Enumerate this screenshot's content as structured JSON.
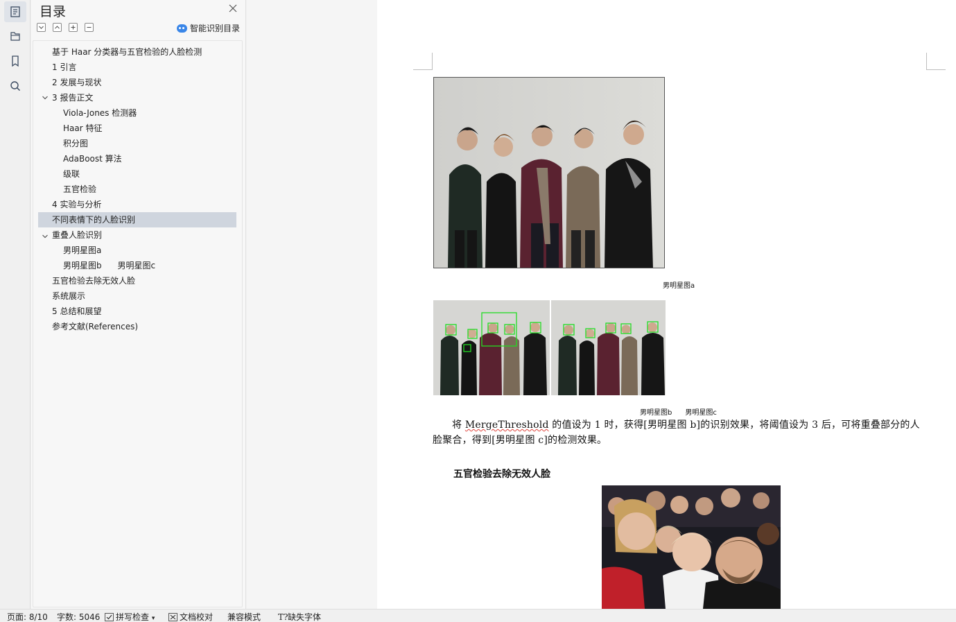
{
  "toc_panel": {
    "title": "目录",
    "smart_toc_label": "智能识别目录",
    "items": [
      {
        "label": "基于 Haar 分类器与五官检验的人脸检测"
      },
      {
        "label": "1  引言"
      },
      {
        "label": "2  发展与现状"
      },
      {
        "label": "3 报告正文",
        "expanded": true
      },
      {
        "label": "Viola-Jones 检测器"
      },
      {
        "label": "Haar 特征"
      },
      {
        "label": "积分图"
      },
      {
        "label": "AdaBoost 算法"
      },
      {
        "label": "级联"
      },
      {
        "label": "五官检验"
      },
      {
        "label": "4 实验与分析"
      },
      {
        "label": "不同表情下的人脸识别",
        "selected": true
      },
      {
        "label": "重叠人脸识别",
        "expanded": true
      },
      {
        "label": "男明星图a"
      },
      {
        "label": "男明星图b      男明星图c"
      },
      {
        "label": "五官检验去除无效人脸"
      },
      {
        "label": "系统展示"
      },
      {
        "label": "5  总结和展望"
      },
      {
        "label": "参考文献(References)"
      }
    ]
  },
  "document": {
    "caption_a": "男明星图a",
    "caption_bc": "男明星图b      男明星图c",
    "paragraph_before": "将 ",
    "paragraph_term": "MergeThreshold",
    "paragraph_after": " 的值设为 1 时，获得[男明星图 b]的识别效果，将阈值设为 3 后，可将重叠部分的人脸聚合，得到[男明星图 c]的检测效果。",
    "section_heading": "五官检验去除无效人脸"
  },
  "status_bar": {
    "page": "页面: 8/10",
    "word_count": "字数: 5046",
    "spell_check": "拼写检查",
    "doc_proof": "文档校对",
    "compat_mode": "兼容模式",
    "missing_fonts": "缺失字体"
  },
  "colors": {
    "selected_row": "#cfd5de",
    "detection_box": "#22dd22",
    "smart_icon": "#3a86e8"
  }
}
